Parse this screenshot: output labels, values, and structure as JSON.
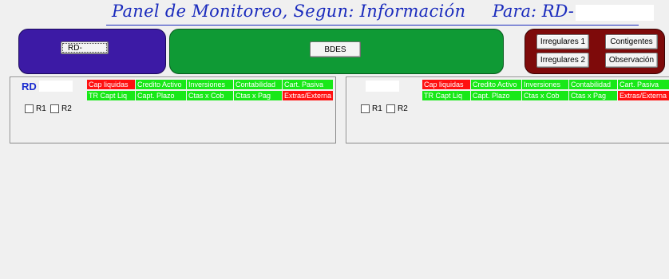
{
  "header": {
    "title": "Panel de Monitoreo, Segun: Información",
    "para_label": "Para: RD-"
  },
  "top_buttons": {
    "rd": "RD-",
    "bdes": "BDES",
    "irregulares1": "Irregulares 1",
    "contigentes": "Contigentes",
    "irregulares2": "Irregulares 2",
    "observacion": "Observación"
  },
  "left_panel": {
    "rd_label": "RD",
    "tags_row1": [
      {
        "label": "Cap liquidas",
        "color": "red"
      },
      {
        "label": "Credito Activo",
        "color": "green"
      },
      {
        "label": "Inversiones",
        "color": "green"
      },
      {
        "label": "Contabilidad",
        "color": "green"
      },
      {
        "label": "Cart. Pasiva",
        "color": "green"
      }
    ],
    "tags_row2": [
      {
        "label": "TR Capt Liq",
        "color": "green"
      },
      {
        "label": "Capt. Plazo",
        "color": "green"
      },
      {
        "label": "Ctas x Cob",
        "color": "green"
      },
      {
        "label": "Ctas x Pag",
        "color": "green"
      },
      {
        "label": "Extras/Externa",
        "color": "red"
      }
    ],
    "checkboxes": [
      {
        "label": "R1",
        "checked": false
      },
      {
        "label": "R2",
        "checked": false
      }
    ]
  },
  "right_panel": {
    "tags_row1": [
      {
        "label": "Cap liquidas",
        "color": "red"
      },
      {
        "label": "Credito Activo",
        "color": "green"
      },
      {
        "label": "Inversiones",
        "color": "green"
      },
      {
        "label": "Contabilidad",
        "color": "green"
      },
      {
        "label": "Cart. Pasiva",
        "color": "green"
      }
    ],
    "tags_row2": [
      {
        "label": "TR Capt Liq",
        "color": "green"
      },
      {
        "label": "Capt. Plazo",
        "color": "green"
      },
      {
        "label": "Ctas x Cob",
        "color": "green"
      },
      {
        "label": "Ctas x Pag",
        "color": "green"
      },
      {
        "label": "Extras/Externa",
        "color": "red"
      }
    ],
    "checkboxes": [
      {
        "label": "R1",
        "checked": false
      },
      {
        "label": "R2",
        "checked": false
      }
    ]
  },
  "colors": {
    "title": "#1a2bbd",
    "purple_panel": "#3c1aa5",
    "green_panel": "#0f9a35",
    "red_panel": "#7e0a0a",
    "tag_red": "#ff1010",
    "tag_green": "#18e818"
  }
}
